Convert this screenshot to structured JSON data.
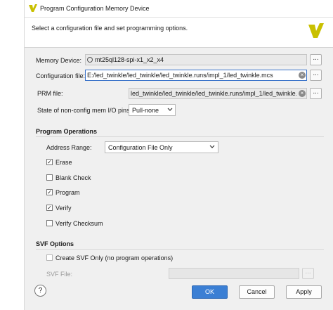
{
  "window": {
    "title": "Program Configuration Memory Device",
    "icon": "vivado-logo-icon"
  },
  "header": {
    "instruction": "Select a configuration file and set programming options."
  },
  "memory_device": {
    "label": "Memory Device:",
    "value": "mt25ql128-spi-x1_x2_x4",
    "icon": "chip-icon"
  },
  "configuration_file": {
    "label": "Configuration file:",
    "value": "E:/led_twinkle/led_twinkle/led_twinkle.runs/impl_1/led_twinkle.mcs"
  },
  "prm_file": {
    "label": "PRM file:",
    "value": "led_twinkle/led_twinkle/led_twinkle.runs/impl_1/led_twinkle.prm"
  },
  "non_config_pins": {
    "label": "State of non-config mem I/O pins:",
    "value": "Pull-none"
  },
  "program_operations": {
    "heading": "Program Operations",
    "address_range_label": "Address Range:",
    "address_range_value": "Configuration File Only",
    "options": [
      {
        "label": "Erase",
        "checked": true
      },
      {
        "label": "Blank Check",
        "checked": false
      },
      {
        "label": "Program",
        "checked": true
      },
      {
        "label": "Verify",
        "checked": true
      },
      {
        "label": "Verify Checksum",
        "checked": false
      }
    ]
  },
  "svf_options": {
    "heading": "SVF Options",
    "create_svf_label": "Create SVF Only (no program operations)",
    "create_svf_checked": false,
    "svf_file_label": "SVF File:",
    "svf_file_value": ""
  },
  "buttons": {
    "help": "?",
    "ok": "OK",
    "cancel": "Cancel",
    "apply": "Apply",
    "browse": "..."
  },
  "colors": {
    "accent": "#3b7fd4",
    "logo": "#c9c000"
  }
}
